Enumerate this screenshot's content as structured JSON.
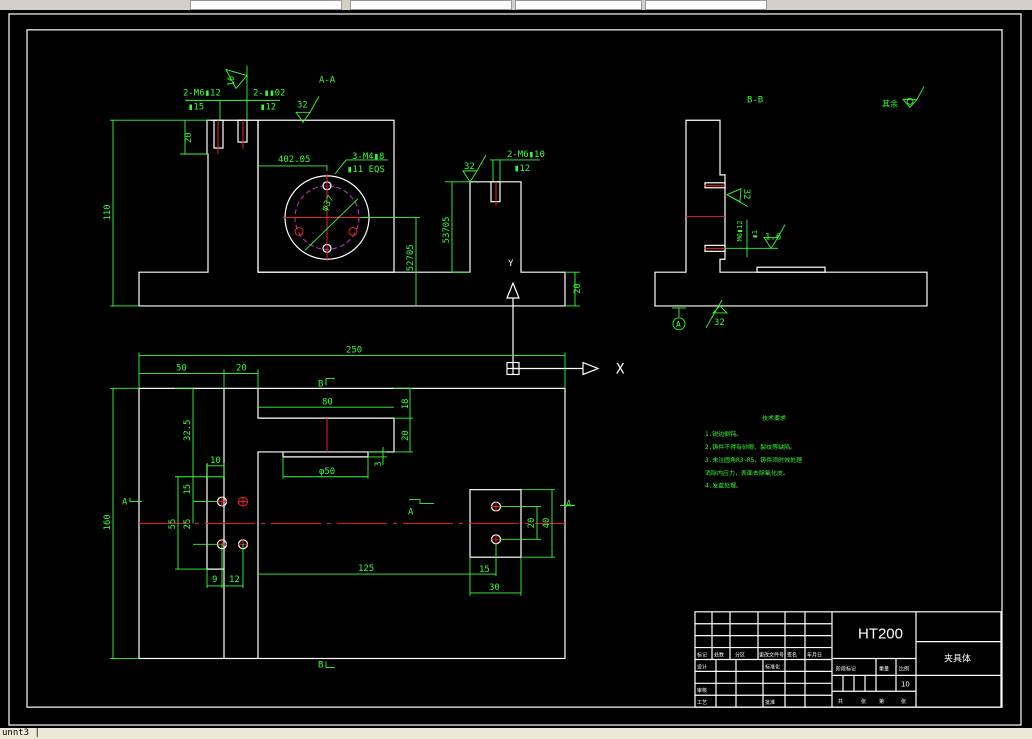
{
  "status_bar": {
    "command_text": "unnt3 |"
  },
  "colors": {
    "background": "#000000",
    "outline": "#ffffff",
    "dimension": "#33ff33",
    "centerline": "#ee2222",
    "hatch": "#66dddd",
    "pitch_circle": "#cc33cc"
  },
  "section_aa": {
    "title": "A-A",
    "callout_left": "2-M6▮12",
    "callout_left_depth": "▮15",
    "callout_mid": "2-▮▮02",
    "callout_mid_depth": "▮12",
    "roughness_top": "16",
    "roughness_cavity": "32",
    "roughness_right": "32",
    "callout_holes": "3-M4▮8",
    "callout_holes_sub": "▮11 EQS",
    "pitch_dia": "φ37",
    "dim_height": "110",
    "dim_step": "20",
    "dim_offset": "402.05",
    "dim_center_height": "52705",
    "dim_right_height": "53705",
    "dim_base": "20",
    "callout_right": "2-M6▮10",
    "callout_right_depth": "▮12"
  },
  "axes": {
    "x_label": "X",
    "y_label": "Y"
  },
  "section_bb": {
    "title": "B-B",
    "other_label": "其余",
    "roughness_side": "32",
    "roughness_hole": "1.6",
    "roughness_bottom": "32",
    "callout_hole": "M6▮12",
    "callout_hole_sub": "▮1",
    "datum": "A"
  },
  "plan_view": {
    "dim_total": "250",
    "dim_50": "50",
    "dim_20": "20",
    "dim_80": "80",
    "dim_18": "18",
    "dim_20b": "20",
    "dim_3": "3",
    "dim_phi50": "φ50",
    "dim_325": "32.5",
    "dim_10": "10",
    "dim_15": "15",
    "dim_25": "25",
    "dim_55": "55",
    "dim_9": "9",
    "dim_12": "12",
    "dim_125": "125",
    "dim_15b": "15",
    "dim_30": "30",
    "dim_20c": "20",
    "dim_40": "40",
    "dim_160": "160",
    "sect_a": "A",
    "sect_b": "B"
  },
  "tech_notes": {
    "title": "技术要求",
    "items": [
      "1.锐边倒钝。",
      "2.铸件不得有砂眼、裂纹等缺陷。",
      "3.未注圆角R3~R5，铸件须时效处理",
      "消除内应力，表面去除氧化皮。",
      "4.发蓝处理。"
    ]
  },
  "title_block": {
    "material": "HT200",
    "part_name": "夹具体",
    "headers": [
      "标记",
      "处数",
      "分区",
      "更改文件号",
      "签名",
      "年月日"
    ],
    "design": "设计",
    "standard": "标准化",
    "review": "审核",
    "process": "工艺",
    "approve": "批准",
    "stage_mark": "阶段标记",
    "weight": "重量",
    "scale": "比例",
    "scale_value": "10",
    "sheet_total": "共",
    "sheet_unit": "张",
    "sheet_no": "第",
    "sheet_unit2": "张"
  }
}
